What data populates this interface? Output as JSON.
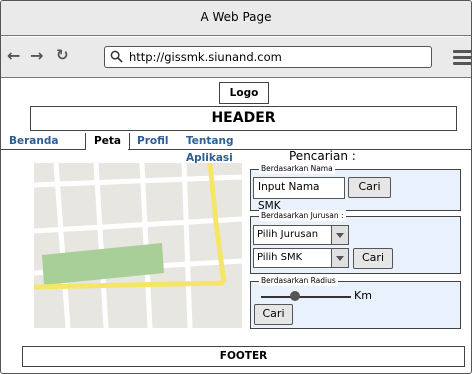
{
  "window": {
    "title": "A Web Page"
  },
  "browser": {
    "url": "http://gissmk.siunand.com"
  },
  "page": {
    "logo": "Logo",
    "header": "HEADER",
    "tabs": [
      {
        "label": "Beranda",
        "active": false
      },
      {
        "label": "Peta",
        "active": true
      },
      {
        "label": "Profil",
        "active": false
      },
      {
        "label": "Tentang Aplikasi",
        "active": false
      }
    ],
    "search": {
      "title": "Pencarian :",
      "by_name": {
        "legend": "Berdasarkan Nama",
        "placeholder": "Input Nama SMK",
        "button": "Cari"
      },
      "by_major": {
        "legend": "Berdasarkan Jurusan :",
        "major_select": "Pilih Jurusan",
        "smk_select": "Pilih SMK",
        "button": "Cari"
      },
      "by_radius": {
        "legend": "Berdasarkan Radius",
        "unit": "Km",
        "button": "Cari"
      }
    },
    "footer": "FOOTER"
  },
  "colors": {
    "tab_link": "#2d5d94",
    "panel_bg": "#e9f1fc",
    "map_road_yellow": "#f5e66a",
    "map_park": "#a9cf98"
  }
}
